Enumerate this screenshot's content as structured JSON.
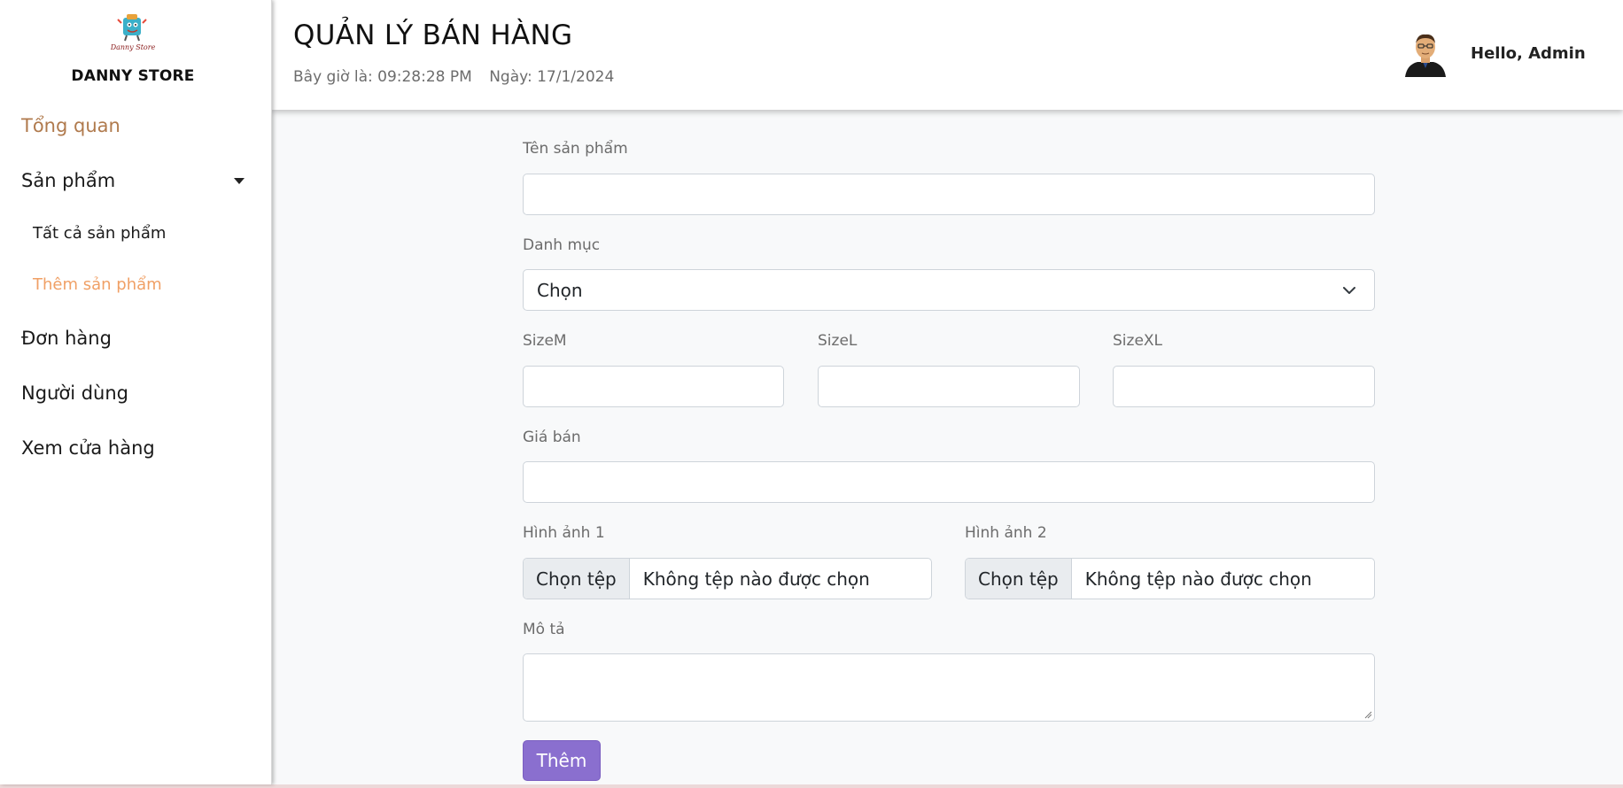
{
  "sidebar": {
    "brand": "DANNY STORE",
    "logo_text": "Danny Store",
    "items": [
      {
        "label": "Tổng quan"
      },
      {
        "label": "Sản phẩm"
      },
      {
        "label": "Tất cả sản phẩm"
      },
      {
        "label": "Thêm sản phẩm"
      },
      {
        "label": "Đơn hàng"
      },
      {
        "label": "Người dùng"
      },
      {
        "label": "Xem cửa hàng"
      }
    ]
  },
  "header": {
    "title": "QUẢN LÝ BÁN HÀNG",
    "time_text": "Bây giờ là: 09:28:28 PM",
    "date_text": "Ngày: 17/1/2024",
    "greeting": "Hello, Admin"
  },
  "form": {
    "name_label": "Tên sản phẩm",
    "category_label": "Danh mục",
    "category_value": "Chọn",
    "size_m_label": "SizeM",
    "size_l_label": "SizeL",
    "size_xl_label": "SizeXL",
    "price_label": "Giá bán",
    "image1_label": "Hình ảnh 1",
    "image2_label": "Hình ảnh 2",
    "file_button": "Chọn tệp",
    "file_status": "Không tệp nào được chọn",
    "description_label": "Mô tả",
    "submit_label": "Thêm"
  },
  "colors": {
    "active_nav": "#b07a4d",
    "active_sub": "#f0a066",
    "submit_bg": "#8a6fcf"
  }
}
